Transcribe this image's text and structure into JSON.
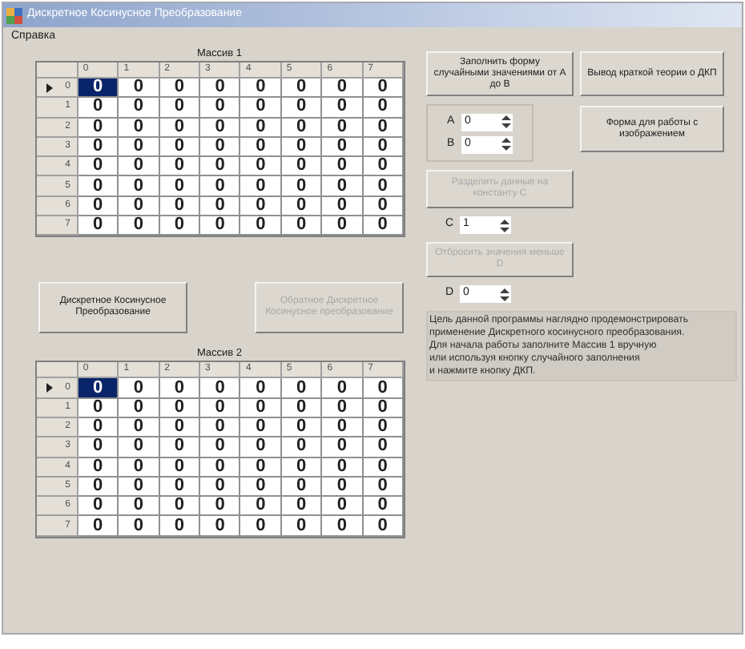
{
  "window": {
    "title": "Дискретное Косинусное Преобразование"
  },
  "menu": [
    "Справка"
  ],
  "grids": [
    {
      "label": "Массив 1",
      "columns": [
        "0",
        "1",
        "2",
        "3",
        "4",
        "5",
        "6",
        "7"
      ],
      "rows": [
        {
          "header": "0",
          "current": true,
          "cells": [
            {
              "value": "0",
              "selected": true
            },
            {
              "value": "0",
              "selected": false
            },
            {
              "value": "0",
              "selected": false
            },
            {
              "value": "0",
              "selected": false
            },
            {
              "value": "0",
              "selected": false
            },
            {
              "value": "0",
              "selected": false
            },
            {
              "value": "0",
              "selected": false
            },
            {
              "value": "0",
              "selected": false
            }
          ]
        },
        {
          "header": "1",
          "current": false,
          "cells": [
            {
              "value": "0",
              "selected": false
            },
            {
              "value": "0",
              "selected": false
            },
            {
              "value": "0",
              "selected": false
            },
            {
              "value": "0",
              "selected": false
            },
            {
              "value": "0",
              "selected": false
            },
            {
              "value": "0",
              "selected": false
            },
            {
              "value": "0",
              "selected": false
            },
            {
              "value": "0",
              "selected": false
            }
          ]
        },
        {
          "header": "2",
          "current": false,
          "cells": [
            {
              "value": "0",
              "selected": false
            },
            {
              "value": "0",
              "selected": false
            },
            {
              "value": "0",
              "selected": false
            },
            {
              "value": "0",
              "selected": false
            },
            {
              "value": "0",
              "selected": false
            },
            {
              "value": "0",
              "selected": false
            },
            {
              "value": "0",
              "selected": false
            },
            {
              "value": "0",
              "selected": false
            }
          ]
        },
        {
          "header": "3",
          "current": false,
          "cells": [
            {
              "value": "0",
              "selected": false
            },
            {
              "value": "0",
              "selected": false
            },
            {
              "value": "0",
              "selected": false
            },
            {
              "value": "0",
              "selected": false
            },
            {
              "value": "0",
              "selected": false
            },
            {
              "value": "0",
              "selected": false
            },
            {
              "value": "0",
              "selected": false
            },
            {
              "value": "0",
              "selected": false
            }
          ]
        },
        {
          "header": "4",
          "current": false,
          "cells": [
            {
              "value": "0",
              "selected": false
            },
            {
              "value": "0",
              "selected": false
            },
            {
              "value": "0",
              "selected": false
            },
            {
              "value": "0",
              "selected": false
            },
            {
              "value": "0",
              "selected": false
            },
            {
              "value": "0",
              "selected": false
            },
            {
              "value": "0",
              "selected": false
            },
            {
              "value": "0",
              "selected": false
            }
          ]
        },
        {
          "header": "5",
          "current": false,
          "cells": [
            {
              "value": "0",
              "selected": false
            },
            {
              "value": "0",
              "selected": false
            },
            {
              "value": "0",
              "selected": false
            },
            {
              "value": "0",
              "selected": false
            },
            {
              "value": "0",
              "selected": false
            },
            {
              "value": "0",
              "selected": false
            },
            {
              "value": "0",
              "selected": false
            },
            {
              "value": "0",
              "selected": false
            }
          ]
        },
        {
          "header": "6",
          "current": false,
          "cells": [
            {
              "value": "0",
              "selected": false
            },
            {
              "value": "0",
              "selected": false
            },
            {
              "value": "0",
              "selected": false
            },
            {
              "value": "0",
              "selected": false
            },
            {
              "value": "0",
              "selected": false
            },
            {
              "value": "0",
              "selected": false
            },
            {
              "value": "0",
              "selected": false
            },
            {
              "value": "0",
              "selected": false
            }
          ]
        },
        {
          "header": "7",
          "current": false,
          "cells": [
            {
              "value": "0",
              "selected": false
            },
            {
              "value": "0",
              "selected": false
            },
            {
              "value": "0",
              "selected": false
            },
            {
              "value": "0",
              "selected": false
            },
            {
              "value": "0",
              "selected": false
            },
            {
              "value": "0",
              "selected": false
            },
            {
              "value": "0",
              "selected": false
            },
            {
              "value": "0",
              "selected": false
            }
          ]
        }
      ]
    },
    {
      "label": "Массив 2",
      "columns": [
        "0",
        "1",
        "2",
        "3",
        "4",
        "5",
        "6",
        "7"
      ],
      "rows": [
        {
          "header": "0",
          "current": true,
          "cells": [
            {
              "value": "0",
              "selected": true
            },
            {
              "value": "0",
              "selected": false
            },
            {
              "value": "0",
              "selected": false
            },
            {
              "value": "0",
              "selected": false
            },
            {
              "value": "0",
              "selected": false
            },
            {
              "value": "0",
              "selected": false
            },
            {
              "value": "0",
              "selected": false
            },
            {
              "value": "0",
              "selected": false
            }
          ]
        },
        {
          "header": "1",
          "current": false,
          "cells": [
            {
              "value": "0",
              "selected": false
            },
            {
              "value": "0",
              "selected": false
            },
            {
              "value": "0",
              "selected": false
            },
            {
              "value": "0",
              "selected": false
            },
            {
              "value": "0",
              "selected": false
            },
            {
              "value": "0",
              "selected": false
            },
            {
              "value": "0",
              "selected": false
            },
            {
              "value": "0",
              "selected": false
            }
          ]
        },
        {
          "header": "2",
          "current": false,
          "cells": [
            {
              "value": "0",
              "selected": false
            },
            {
              "value": "0",
              "selected": false
            },
            {
              "value": "0",
              "selected": false
            },
            {
              "value": "0",
              "selected": false
            },
            {
              "value": "0",
              "selected": false
            },
            {
              "value": "0",
              "selected": false
            },
            {
              "value": "0",
              "selected": false
            },
            {
              "value": "0",
              "selected": false
            }
          ]
        },
        {
          "header": "3",
          "current": false,
          "cells": [
            {
              "value": "0",
              "selected": false
            },
            {
              "value": "0",
              "selected": false
            },
            {
              "value": "0",
              "selected": false
            },
            {
              "value": "0",
              "selected": false
            },
            {
              "value": "0",
              "selected": false
            },
            {
              "value": "0",
              "selected": false
            },
            {
              "value": "0",
              "selected": false
            },
            {
              "value": "0",
              "selected": false
            }
          ]
        },
        {
          "header": "4",
          "current": false,
          "cells": [
            {
              "value": "0",
              "selected": false
            },
            {
              "value": "0",
              "selected": false
            },
            {
              "value": "0",
              "selected": false
            },
            {
              "value": "0",
              "selected": false
            },
            {
              "value": "0",
              "selected": false
            },
            {
              "value": "0",
              "selected": false
            },
            {
              "value": "0",
              "selected": false
            },
            {
              "value": "0",
              "selected": false
            }
          ]
        },
        {
          "header": "5",
          "current": false,
          "cells": [
            {
              "value": "0",
              "selected": false
            },
            {
              "value": "0",
              "selected": false
            },
            {
              "value": "0",
              "selected": false
            },
            {
              "value": "0",
              "selected": false
            },
            {
              "value": "0",
              "selected": false
            },
            {
              "value": "0",
              "selected": false
            },
            {
              "value": "0",
              "selected": false
            },
            {
              "value": "0",
              "selected": false
            }
          ]
        },
        {
          "header": "6",
          "current": false,
          "cells": [
            {
              "value": "0",
              "selected": false
            },
            {
              "value": "0",
              "selected": false
            },
            {
              "value": "0",
              "selected": false
            },
            {
              "value": "0",
              "selected": false
            },
            {
              "value": "0",
              "selected": false
            },
            {
              "value": "0",
              "selected": false
            },
            {
              "value": "0",
              "selected": false
            },
            {
              "value": "0",
              "selected": false
            }
          ]
        },
        {
          "header": "7",
          "current": false,
          "cells": [
            {
              "value": "0",
              "selected": false
            },
            {
              "value": "0",
              "selected": false
            },
            {
              "value": "0",
              "selected": false
            },
            {
              "value": "0",
              "selected": false
            },
            {
              "value": "0",
              "selected": false
            },
            {
              "value": "0",
              "selected": false
            },
            {
              "value": "0",
              "selected": false
            },
            {
              "value": "0",
              "selected": false
            }
          ]
        }
      ]
    }
  ],
  "transform_buttons": [
    {
      "label": "Дискретное Косинусное Преобразование",
      "disabled": false
    },
    {
      "label": "Обратное Дискретное Косинусное преобразование",
      "disabled": true
    }
  ],
  "fill_button": {
    "label": "Заполнить форму случайными значениями от A до B",
    "disabled": false
  },
  "theory_button": {
    "label": "Вывод краткой теории о ДКП",
    "disabled": false
  },
  "image_button": {
    "label": "Форма для работы с изображением",
    "disabled": false
  },
  "range_spinners": [
    {
      "label": "A",
      "value": "0"
    },
    {
      "label": "B",
      "value": "0"
    }
  ],
  "divide_button": {
    "label": "Разделить данные на константу C",
    "disabled": true
  },
  "c_spinner": {
    "label": "C",
    "value": "1"
  },
  "discard_button": {
    "label": "Отбросить значения меньше D",
    "disabled": true
  },
  "d_spinner": {
    "label": "D",
    "value": "0"
  },
  "info_lines": [
    "Цель данной программы наглядно продемонстрировать",
    "применение Дискретного косинусного преобразования.",
    "Для начала работы заполните Массив 1 вручную",
    "или используя кнопку случайного заполнения",
    "и нажмите кнопку ДКП."
  ]
}
